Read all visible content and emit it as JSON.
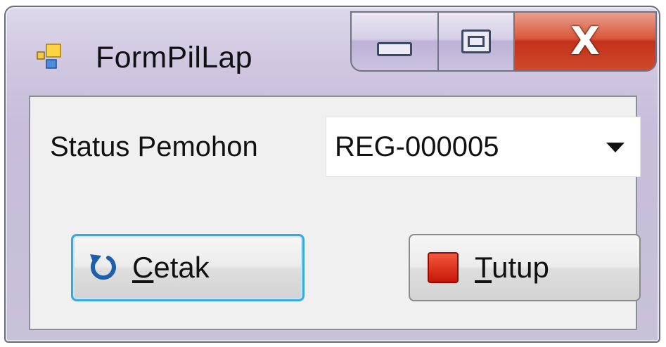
{
  "window": {
    "title": "FormPilLap",
    "controls": {
      "minimize_icon": "minimize-icon",
      "maximize_icon": "maximize-icon",
      "close_icon": "close-icon",
      "close_glyph": "X"
    }
  },
  "form": {
    "status_label": "Status Pemohon",
    "status_combo": {
      "value": "REG-000005",
      "arrow_icon": "dropdown-arrow-icon"
    },
    "print_button": {
      "mnemonic": "C",
      "rest": "etak",
      "icon": "refresh-icon"
    },
    "close_button": {
      "mnemonic": "T",
      "rest": "utup",
      "icon": "stop-icon"
    }
  },
  "colors": {
    "focus_border": "#3ca8dd",
    "close_button_red": "#c3321a",
    "stop_icon_red": "#d4210f",
    "refresh_icon_blue": "#1d5fae"
  }
}
